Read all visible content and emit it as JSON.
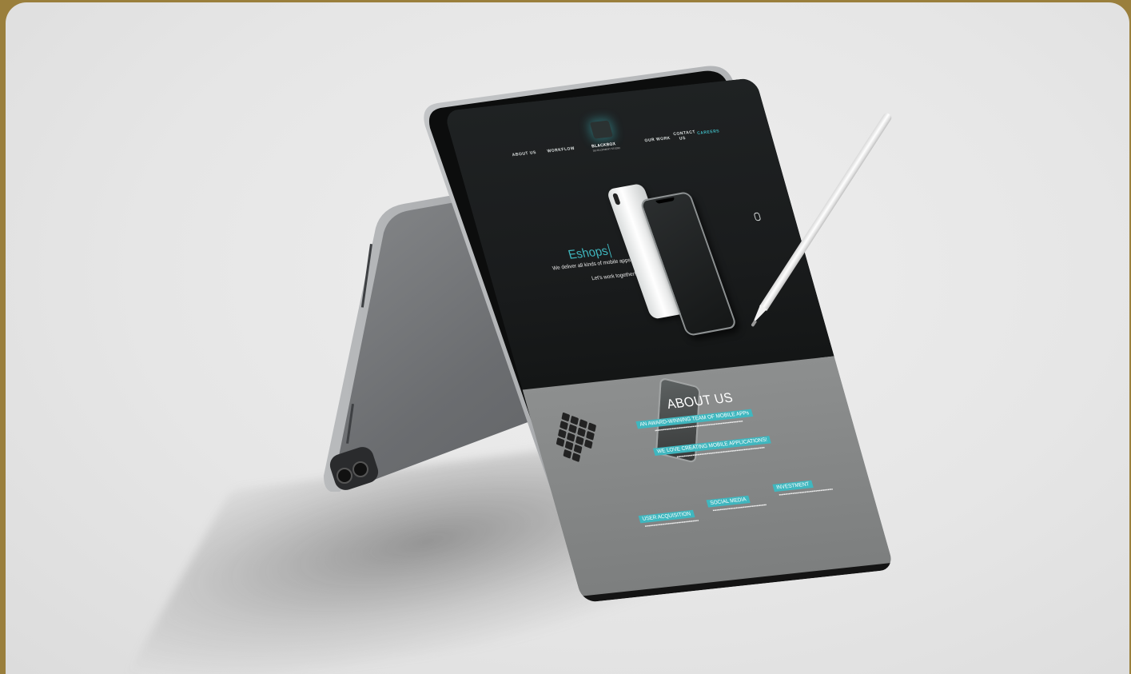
{
  "nav": {
    "about_us": "ABOUT US",
    "workflow": "WORKFLOW",
    "our_work": "OUR WORK",
    "contact_us": "CONTACT US",
    "careers": "CAREERS"
  },
  "logo": {
    "name": "BLACKBOX",
    "tagline": "DEVELOPMENT STUDIO"
  },
  "hero": {
    "title": "Eshops",
    "subtitle": "We deliver all kinds of mobile apps.",
    "cta": "Let's work together!"
  },
  "about": {
    "title": "ABOUT US",
    "band1": "AN AWARD-WINNING TEAM OF MOBILE APPs",
    "band2": "WE LOVE CREATING MOBILE APPLICATIONS!",
    "services": [
      {
        "label": "USER ACQUISITION"
      },
      {
        "label": "SOCIAL MEDIA"
      },
      {
        "label": "INVESTMENT"
      }
    ]
  },
  "colors": {
    "accent": "#3fb7bf",
    "background": "#e6e6e6",
    "border": "#9a7f3c"
  }
}
